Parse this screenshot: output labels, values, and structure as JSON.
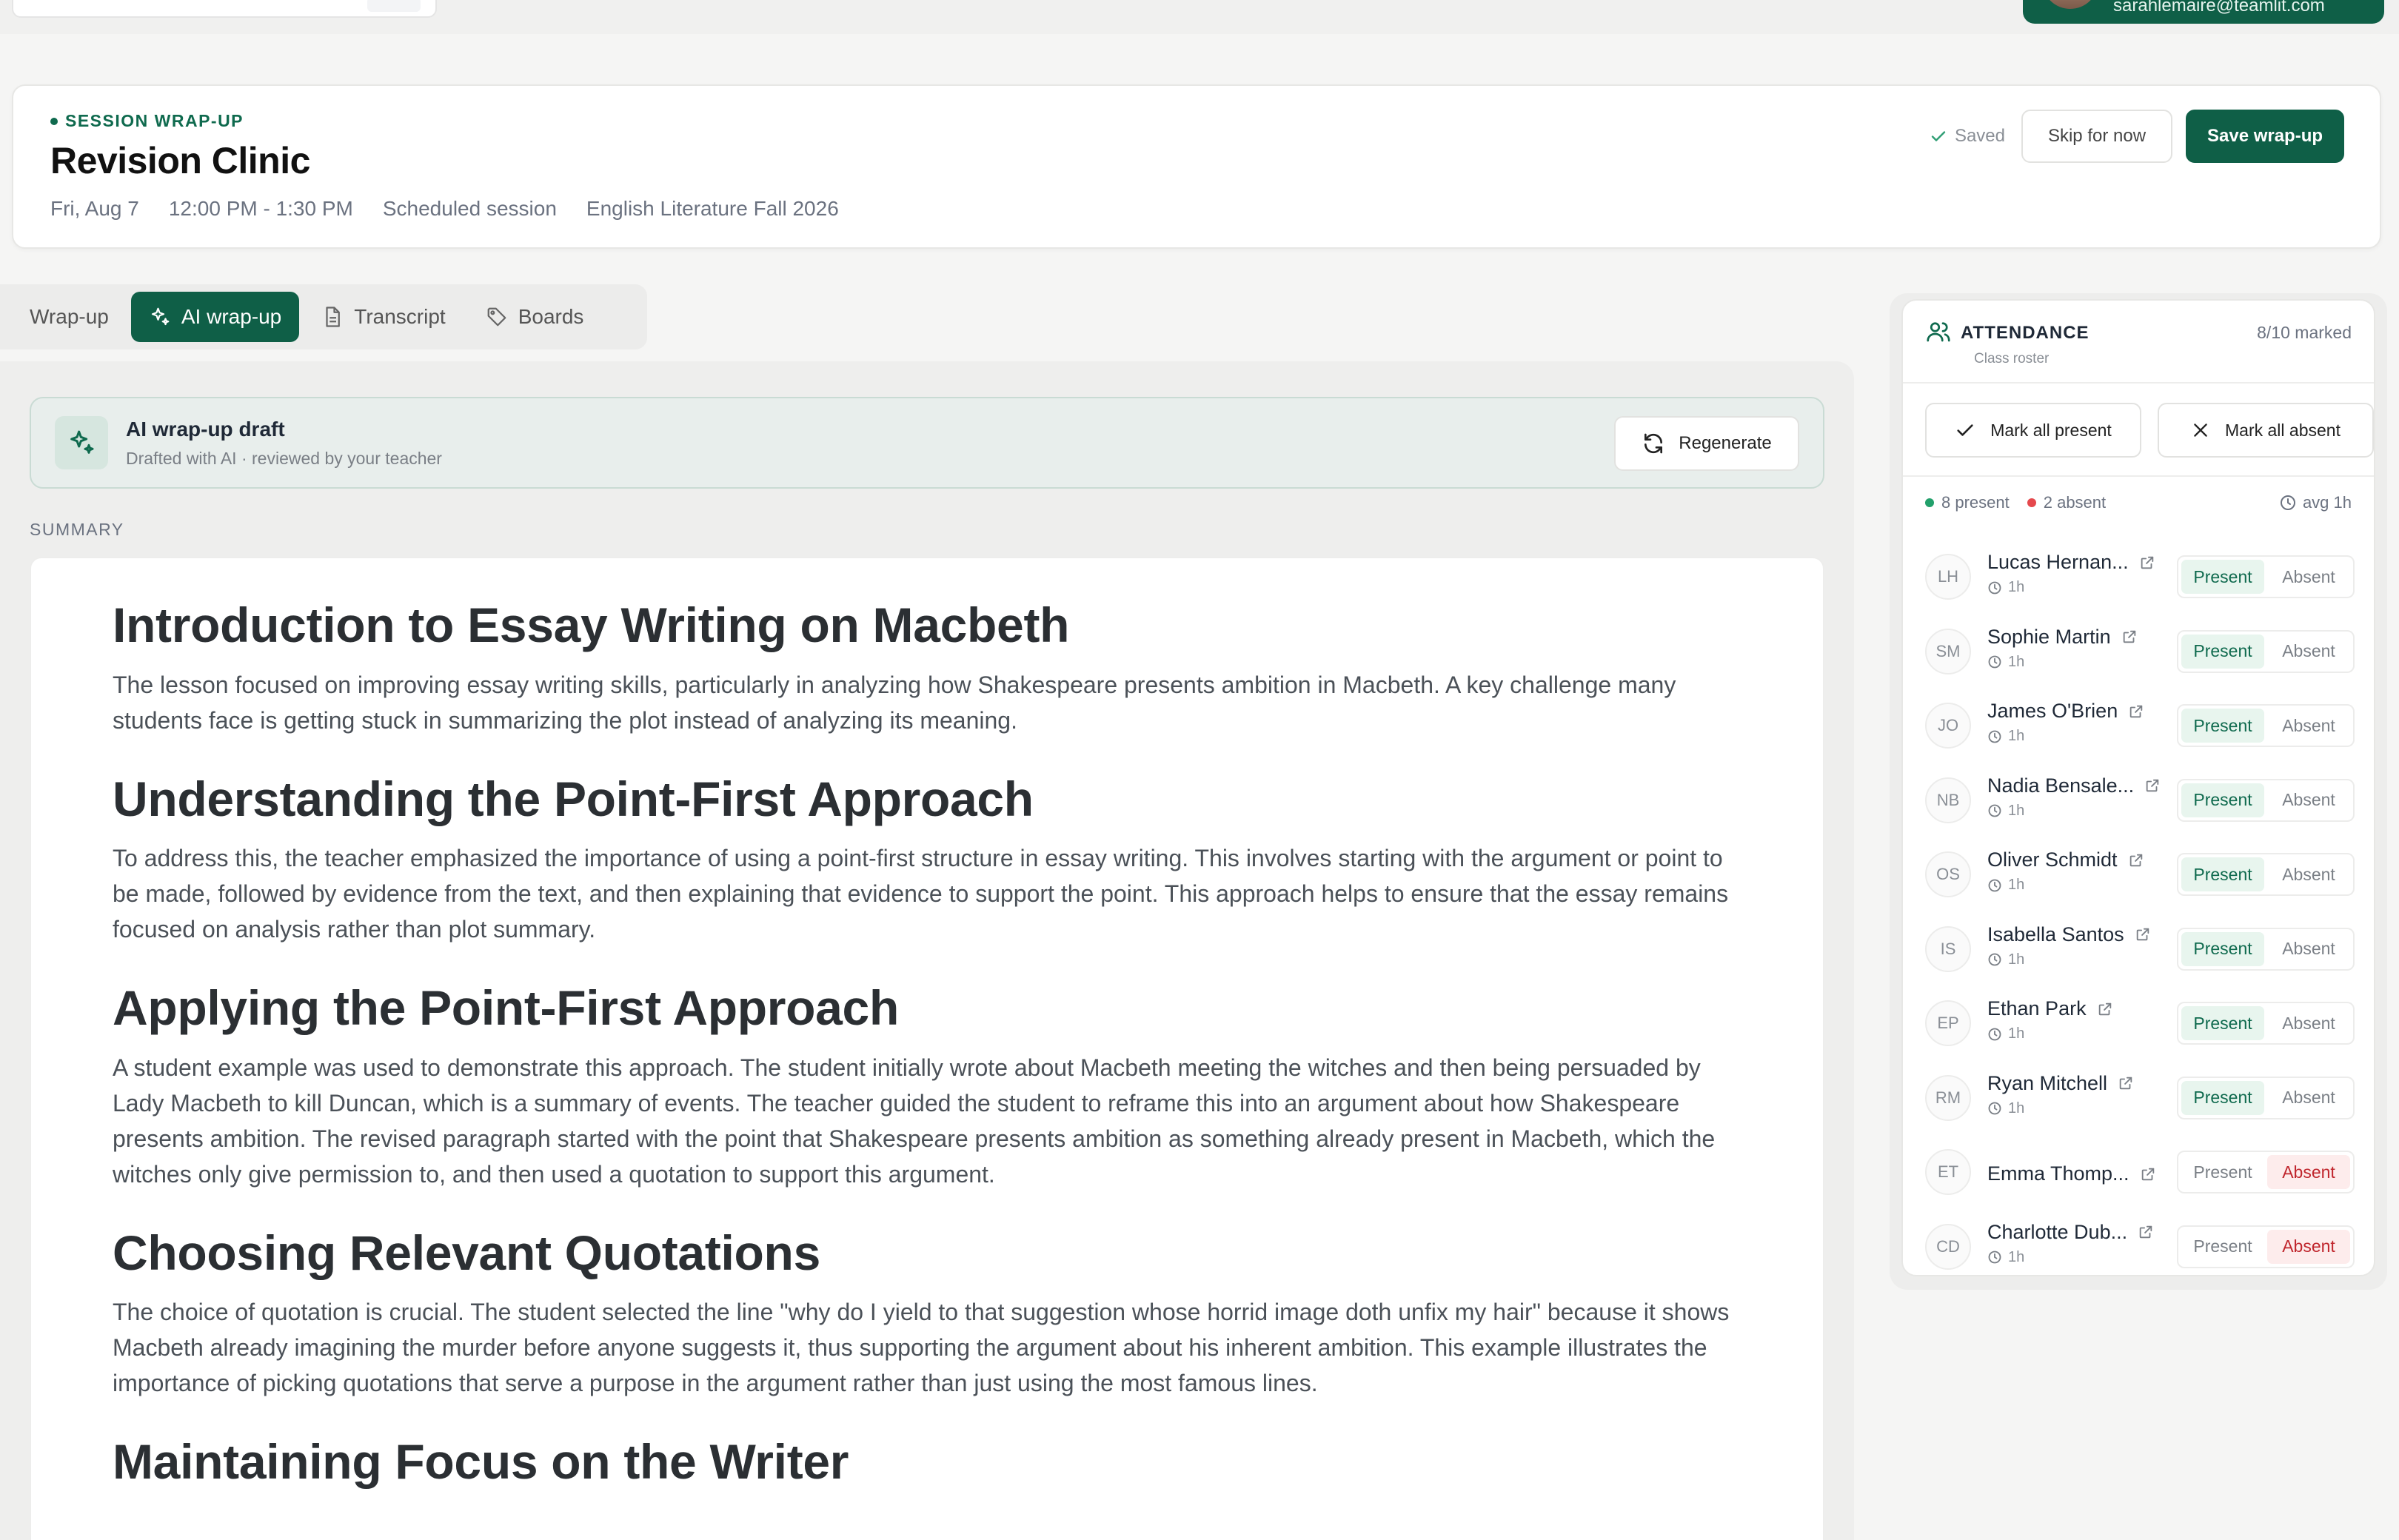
{
  "user": {
    "email": "sarahlemaire@teamlit.com"
  },
  "session": {
    "eyebrow": "SESSION WRAP-UP",
    "title": "Revision Clinic",
    "date": "Fri, Aug 7",
    "time": "12:00 PM - 1:30 PM",
    "type": "Scheduled session",
    "course": "English Literature Fall 2026",
    "saved_label": "Saved",
    "skip_label": "Skip for now",
    "save_label": "Save wrap-up"
  },
  "tabs": [
    {
      "label": "Wrap-up",
      "active": false
    },
    {
      "label": "AI wrap-up",
      "active": true
    },
    {
      "label": "Transcript",
      "active": false
    },
    {
      "label": "Boards",
      "active": false
    }
  ],
  "draft": {
    "title": "AI wrap-up draft",
    "subtitle": "Drafted with AI · reviewed by your teacher",
    "regenerate_label": "Regenerate"
  },
  "summary": {
    "label": "SUMMARY",
    "sections": [
      {
        "heading": "Introduction to Essay Writing on Macbeth",
        "body": "The lesson focused on improving essay writing skills, particularly in analyzing how Shakespeare presents ambition in Macbeth. A key challenge many students face is getting stuck in summarizing the plot instead of analyzing its meaning."
      },
      {
        "heading": "Understanding the Point-First Approach",
        "body": "To address this, the teacher emphasized the importance of using a point-first structure in essay writing. This involves starting with the argument or point to be made, followed by evidence from the text, and then explaining that evidence to support the point. This approach helps to ensure that the essay remains focused on analysis rather than plot summary."
      },
      {
        "heading": "Applying the Point-First Approach",
        "body": "A student example was used to demonstrate this approach. The student initially wrote about Macbeth meeting the witches and then being persuaded by Lady Macbeth to kill Duncan, which is a summary of events. The teacher guided the student to reframe this into an argument about how Shakespeare presents ambition. The revised paragraph started with the point that Shakespeare presents ambition as something already present in Macbeth, which the witches only give permission to, and then used a quotation to support this argument."
      },
      {
        "heading": "Choosing Relevant Quotations",
        "body": "The choice of quotation is crucial. The student selected the line \"why do I yield to that suggestion whose horrid image doth unfix my hair\" because it shows Macbeth already imagining the murder before anyone suggests it, thus supporting the argument about his inherent ambition. This example illustrates the importance of picking quotations that serve a purpose in the argument rather than just using the most famous lines."
      },
      {
        "heading": "Maintaining Focus on the Writer",
        "body": ""
      }
    ]
  },
  "attendance": {
    "title": "ATTENDANCE",
    "subtitle": "Class roster",
    "count": "8/10 marked",
    "mark_all_present": "Mark all present",
    "mark_all_absent": "Mark all absent",
    "present_stat": "8 present",
    "absent_stat": "2 absent",
    "avg_stat": "avg 1h",
    "present_label": "Present",
    "absent_label": "Absent",
    "colors": {
      "present": "#22a06b",
      "absent": "#e5484d",
      "brand": "#0f5f47"
    },
    "students": [
      {
        "initials": "LH",
        "name": "Lucas Hernan...",
        "duration": "1h",
        "status": "present"
      },
      {
        "initials": "SM",
        "name": "Sophie Martin",
        "duration": "1h",
        "status": "present"
      },
      {
        "initials": "JO",
        "name": "James O'Brien",
        "duration": "1h",
        "status": "present"
      },
      {
        "initials": "NB",
        "name": "Nadia Bensale...",
        "duration": "1h",
        "status": "present"
      },
      {
        "initials": "OS",
        "name": "Oliver Schmidt",
        "duration": "1h",
        "status": "present"
      },
      {
        "initials": "IS",
        "name": "Isabella Santos",
        "duration": "1h",
        "status": "present"
      },
      {
        "initials": "EP",
        "name": "Ethan Park",
        "duration": "1h",
        "status": "present"
      },
      {
        "initials": "RM",
        "name": "Ryan Mitchell",
        "duration": "1h",
        "status": "present"
      },
      {
        "initials": "ET",
        "name": "Emma Thomp...",
        "duration": "",
        "status": "absent"
      },
      {
        "initials": "CD",
        "name": "Charlotte Dub...",
        "duration": "1h",
        "status": "absent"
      }
    ]
  }
}
